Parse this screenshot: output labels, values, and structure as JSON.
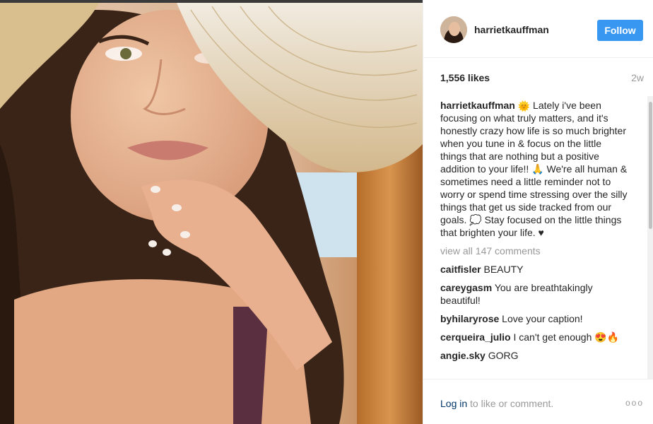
{
  "post": {
    "username": "harriet­kauffman",
    "follow_label": "Follow",
    "likes": "1,556 likes",
    "age": "2w",
    "caption": {
      "username": "harrietkauffman",
      "text": "Lately i've been focusing on what truly matters, and it's honestly crazy how life is so much brighter when you tune in & focus on the little things that are nothing but a positive addition to your life!! 🙏 We're all human & sometimes need a little reminder not to worry or spend time stressing over the silly things that get us side tracked from our goals. 💭 Stay focused on the little things that brighten your life. ♥"
    },
    "view_all": "view all 147 comments",
    "comments": [
      {
        "user": "caitfisler",
        "text": "BEAUTY"
      },
      {
        "user": "careygasm",
        "text": "You are breathtakingly beautiful!"
      },
      {
        "user": "byhilaryrose",
        "text": "Love your caption!"
      },
      {
        "user": "cerqueira_julio",
        "text": "I can't get enough 😍🔥"
      },
      {
        "user": "angie.sky",
        "text": "GORG"
      }
    ],
    "footer": {
      "login_link": "Log in",
      "login_rest": " to like or comment.",
      "more": "ooo"
    }
  },
  "colors": {
    "follow_button": "#3897f0",
    "link": "#003569",
    "muted": "#999999"
  },
  "icons": {
    "sun_emoji": "sun-face-icon",
    "more": "more-options-icon"
  }
}
